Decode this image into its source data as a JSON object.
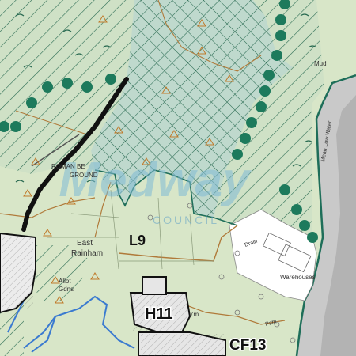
{
  "map": {
    "labels": {
      "recreation_ground_1": "ROMAN BE",
      "recreation_ground_2": "GROUND",
      "east_1": "East",
      "east_2": "Rainham",
      "allot_1": "Allot",
      "allot_2": "Gdns",
      "mud": "Mud",
      "warehouses": "Warehouses",
      "path": "Path",
      "drain": "Drain",
      "spot_height": "7m",
      "mean_water": "Mean Low Water"
    },
    "policy_codes": {
      "l9": "L9",
      "h11": "H11",
      "cf13": "CF13"
    },
    "watermark": {
      "name": "Medway",
      "sub": "COUNCIL"
    },
    "colors": {
      "base": "#d8e6c8",
      "hatch_green": "#2a6b52",
      "tree_dot": "#1d7a5c",
      "boundary_teal": "#1e6e59",
      "rail_black": "#111111",
      "road_brown": "#b07a3a",
      "water_blue": "#3a7ad0",
      "river_grey": "#c9c9c9",
      "warehouse_white": "#ffffff"
    }
  }
}
